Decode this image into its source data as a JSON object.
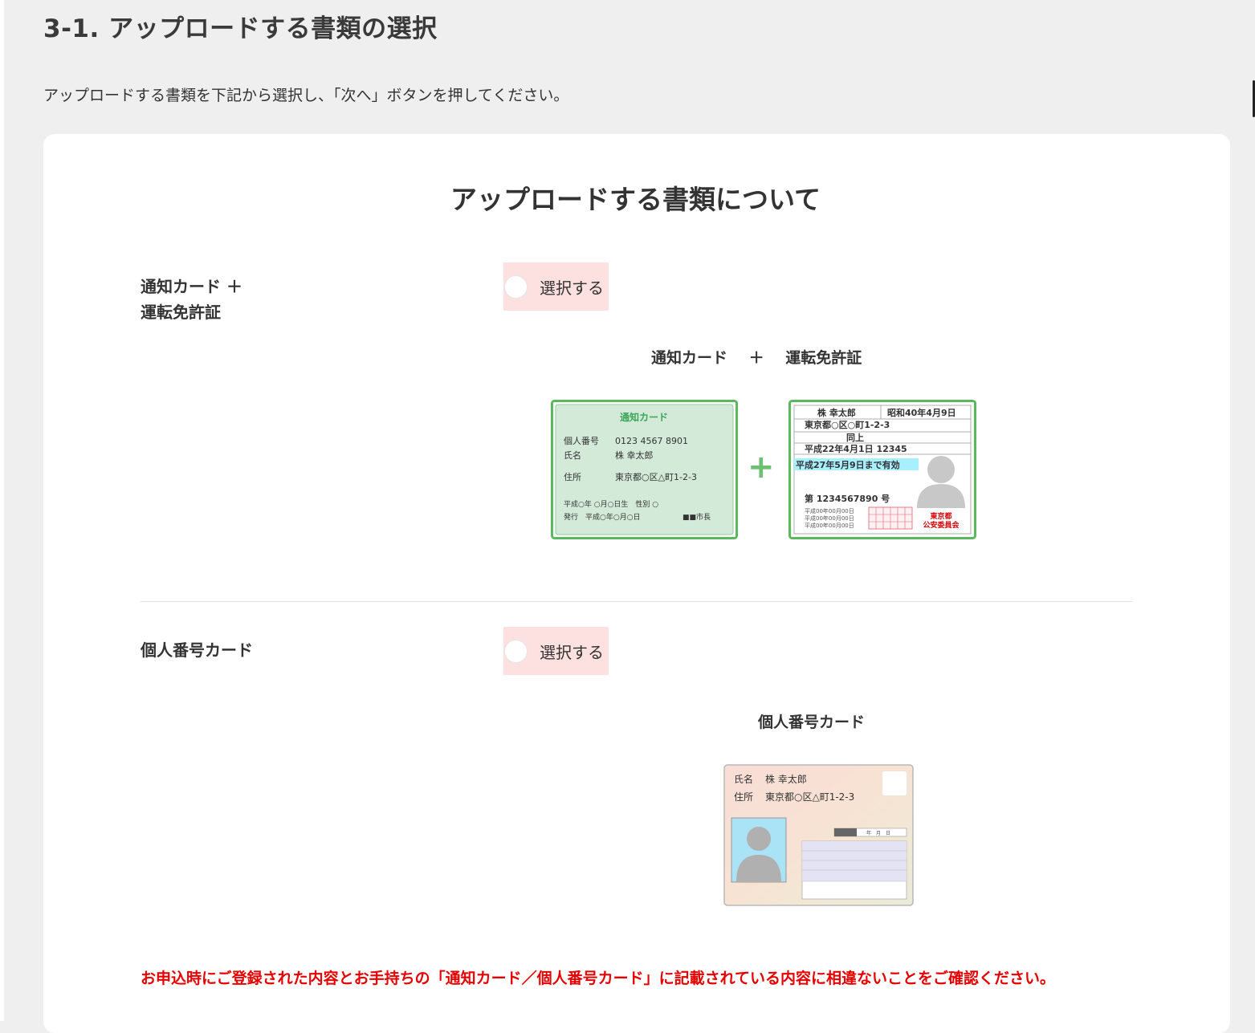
{
  "page": {
    "title": "3-1. アップロードする書類の選択",
    "instruction": "アップロードする書類を下記から選択し、「次へ」ボタンを押してください。"
  },
  "panel": {
    "heading": "アップロードする書類について"
  },
  "options": [
    {
      "label_line1": "通知カード ＋",
      "label_line2": "運転免許証",
      "select_label": "選択する",
      "caption_part1": "通知カード",
      "caption_plus": "＋",
      "caption_part2": "運転免許証"
    },
    {
      "label": "個人番号カード",
      "select_label": "選択する",
      "caption": "個人番号カード"
    }
  ],
  "notification_card": {
    "title": "通知カード",
    "number_label": "個人番号",
    "number_value": "0123 4567 8901",
    "name_label": "氏名",
    "name_value": "株 幸太郎",
    "address_label": "住所",
    "address_value": "東京都○区△町1-2-3",
    "birth_line": "平成○年 ○月○日生　性別 ○",
    "issue_line": "発行　平成○年○月○日",
    "issuer": "■■市長"
  },
  "license_card": {
    "name": "株 幸太郎",
    "birth": "昭和40年4月9日",
    "address": "東京都○区○町1-2-3",
    "same": "同上",
    "issue": "平成22年4月1日  12345",
    "valid": "平成27年5月9日まで有効",
    "number": "第 1234567890 号",
    "history1": "平成00年00月00日",
    "history2": "平成00年00月00日",
    "history3": "平成00年00月00日",
    "issuer1": "東京都",
    "issuer2": "公安委員会"
  },
  "mynumber_card": {
    "name_label": "氏名",
    "name_value": "株 幸太郎",
    "address_label": "住所",
    "address_value": "東京都○区△町1-2-3",
    "date_label": "年　月　日"
  },
  "plus_symbol": "+",
  "warning": "お申込時にご登録された内容とお手持ちの「通知カード／個人番号カード」に記載されている内容に相違ないことをご確認ください。",
  "colors": {
    "background": "#efefef",
    "select_button": "#fde0e0",
    "warning": "#e60000",
    "card_green": "#5cb85c"
  }
}
